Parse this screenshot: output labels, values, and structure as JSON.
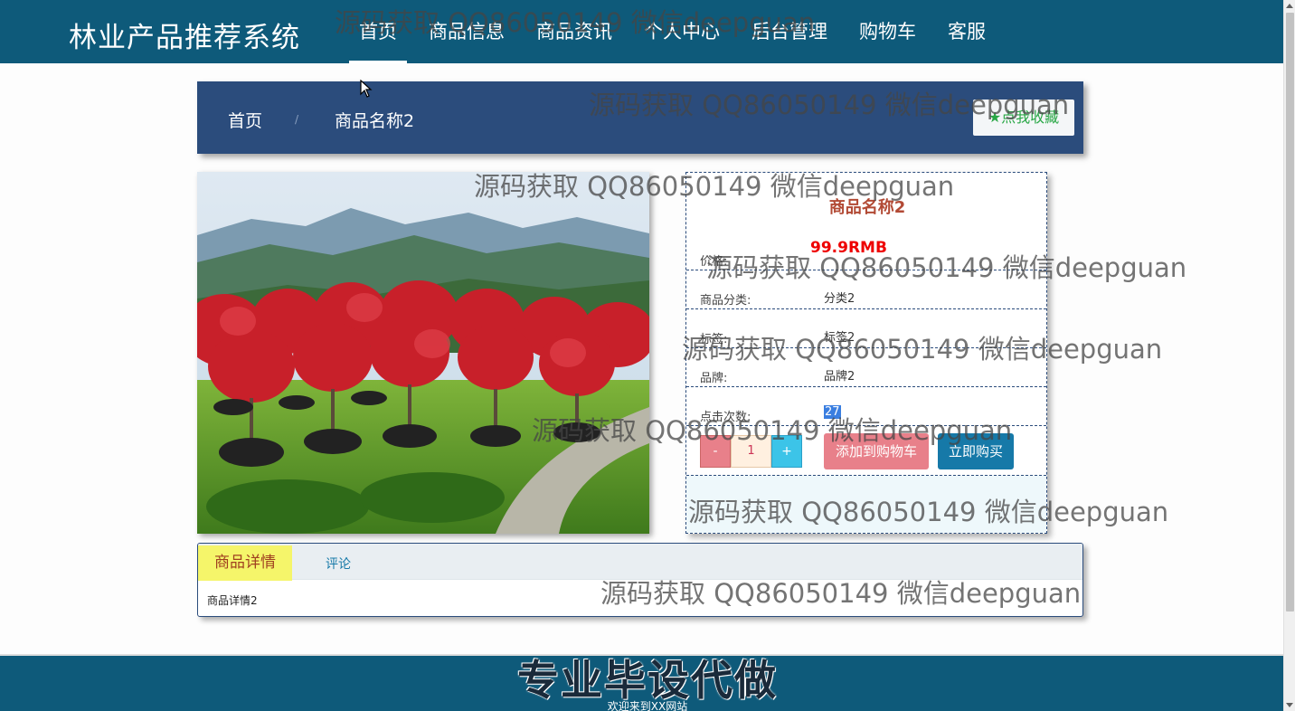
{
  "header": {
    "brand": "林业产品推荐系统",
    "nav": [
      "首页",
      "商品信息",
      "商品资讯",
      "个人中心",
      "后台管理",
      "购物车",
      "客服"
    ]
  },
  "breadcrumb": {
    "home": "首页",
    "separator": "/",
    "current": "商品名称2",
    "favorite_label": "★点我收藏"
  },
  "product": {
    "image_alt": "red maple trees on hillside",
    "title": "商品名称2",
    "price_label": "价格:",
    "price_value": "99.9RMB",
    "category_label": "商品分类:",
    "category_value": "分类2",
    "tag_label": "标签:",
    "tag_value": "标签2",
    "brand_label": "品牌:",
    "brand_value": "品牌2",
    "clicks_label": "点击次数:",
    "clicks_value": "27",
    "qty_minus": "-",
    "qty_value": "1",
    "qty_plus": "+",
    "add_to_cart": "添加到购物车",
    "buy_now": "立即购买"
  },
  "tabs": {
    "detail_tab": "商品详情",
    "review_tab": "评论",
    "detail_content": "商品详情2"
  },
  "footer": {
    "banner": "专业毕设代做",
    "welcome": "欢迎来到XX网站"
  },
  "watermark": "源码获取 QQ86050149 微信deepguan",
  "colors": {
    "header_bg": "#0e5a7a",
    "breadcrumb_bg": "#2b4c7c",
    "price": "#e00000",
    "favorite": "#28a745",
    "cart_button": "#e8808a",
    "buy_button": "#1679a8"
  }
}
